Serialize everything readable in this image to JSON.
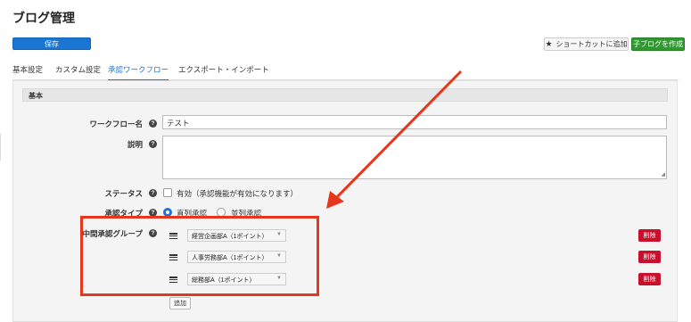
{
  "page": {
    "title": "ブログ管理"
  },
  "toolbar": {
    "save_label": "保存",
    "shortcut_label": "ショートカットに追加",
    "child_blog_label": "子ブログを作成"
  },
  "tabs": [
    {
      "label": "基本設定",
      "active": false
    },
    {
      "label": "カスタム設定",
      "active": false
    },
    {
      "label": "承認ワークフロー",
      "active": true
    },
    {
      "label": "エクスポート・インポート",
      "active": false
    }
  ],
  "section": {
    "title": "基本"
  },
  "form": {
    "workflow_name_label": "ワークフロー名",
    "workflow_name_value": "テスト",
    "description_label": "説明",
    "description_value": "",
    "status_label": "ステータス",
    "status_checkbox_text": "有効（承認機能が有効になります）",
    "status_checked": false,
    "approval_type_label": "承認タイプ",
    "approval_type_options": [
      {
        "label": "直列承認",
        "selected": true
      },
      {
        "label": "並列承認",
        "selected": false
      }
    ],
    "middle_group_label": "中間承認グループ",
    "groups": [
      {
        "value": "経営企画部A（1ポイント）",
        "delete_label": "削除"
      },
      {
        "value": "人事労務部A（1ポイント）",
        "delete_label": "削除"
      },
      {
        "value": "総務部A（1ポイント）",
        "delete_label": "削除"
      }
    ],
    "add_label": "追加"
  },
  "colors": {
    "accent": "#1a76d2",
    "green": "#2e9a2e",
    "danger": "#c8102e",
    "annotation": "#e8361c"
  }
}
